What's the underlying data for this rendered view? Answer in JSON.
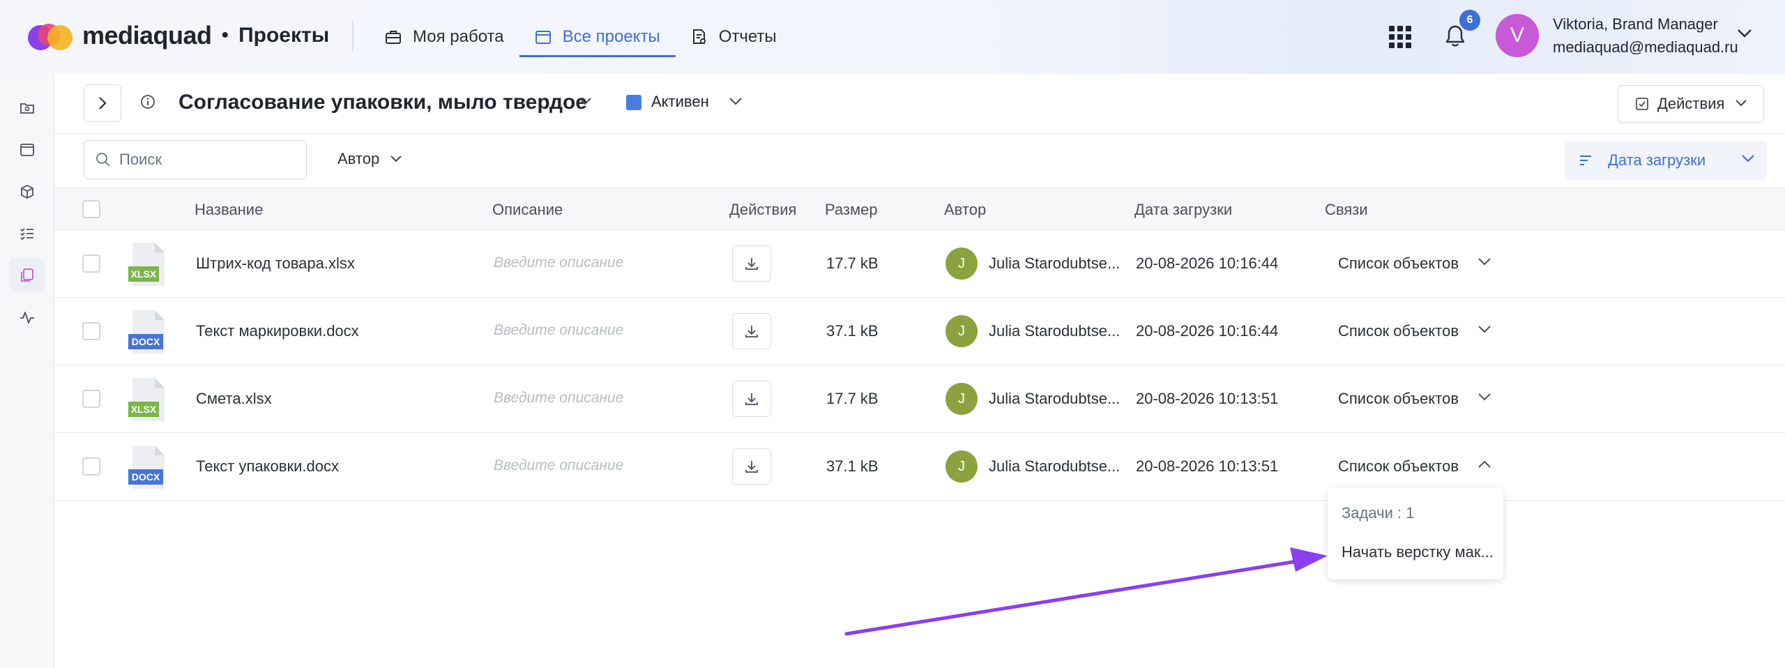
{
  "brand": {
    "name": "mediaquad",
    "separator": "•",
    "section": "Проекты"
  },
  "nav": [
    {
      "label": "Моя работа",
      "icon": "briefcase-icon"
    },
    {
      "label": "Все проекты",
      "icon": "window-icon",
      "active": true
    },
    {
      "label": "Отчеты",
      "icon": "report-icon"
    }
  ],
  "notifications": {
    "count": "6"
  },
  "user": {
    "initial": "V",
    "name": "Viktoria, Brand Manager",
    "email": "mediaquad@mediaquad.ru"
  },
  "sidebar": {
    "icons": [
      "folder-icon",
      "window-icon",
      "cube-icon",
      "checklist-icon",
      "files-icon",
      "activity-icon"
    ],
    "active_index": 4
  },
  "project": {
    "title": "Согласование упаковки, мыло твердое",
    "status": "Активен",
    "status_color": "#4a7be0",
    "actions_label": "Действия"
  },
  "filters": {
    "search_placeholder": "Поиск",
    "author_label": "Автор",
    "sort_label": "Дата загрузки"
  },
  "table": {
    "columns": {
      "name": "Название",
      "description": "Описание",
      "actions": "Действия",
      "size": "Размер",
      "author": "Автор",
      "date": "Дата загрузки",
      "links": "Связи"
    },
    "rows": [
      {
        "ext": "XLSX",
        "ext_color": "#7ab648",
        "name": "Штрих-код товара.xlsx",
        "description": "Введите описание",
        "size": "17.7 kB",
        "author_initial": "J",
        "author": "Julia Starodubtse...",
        "date": "20-08-2026 10:16:44",
        "links": "Список объектов"
      },
      {
        "ext": "DOCX",
        "ext_color": "#4a73d6",
        "name": "Текст маркировки.docx",
        "description": "Введите описание",
        "size": "37.1 kB",
        "author_initial": "J",
        "author": "Julia Starodubtse...",
        "date": "20-08-2026 10:16:44",
        "links": "Список объектов"
      },
      {
        "ext": "XLSX",
        "ext_color": "#7ab648",
        "name": "Смета.xlsx",
        "description": "Введите описание",
        "size": "17.7 kB",
        "author_initial": "J",
        "author": "Julia Starodubtse...",
        "date": "20-08-2026 10:13:51",
        "links": "Список объектов"
      },
      {
        "ext": "DOCX",
        "ext_color": "#4a73d6",
        "name": "Текст упаковки.docx",
        "description": "Введите описание",
        "size": "37.1 kB",
        "author_initial": "J",
        "author": "Julia Starodubtse...",
        "date": "20-08-2026 10:13:51",
        "links": "Список объектов",
        "expanded": true
      }
    ]
  },
  "popup": {
    "heading": "Задачи : 1",
    "task": "Начать верстку мак..."
  },
  "annotation": {
    "arrow_color": "#8a3ff0"
  }
}
